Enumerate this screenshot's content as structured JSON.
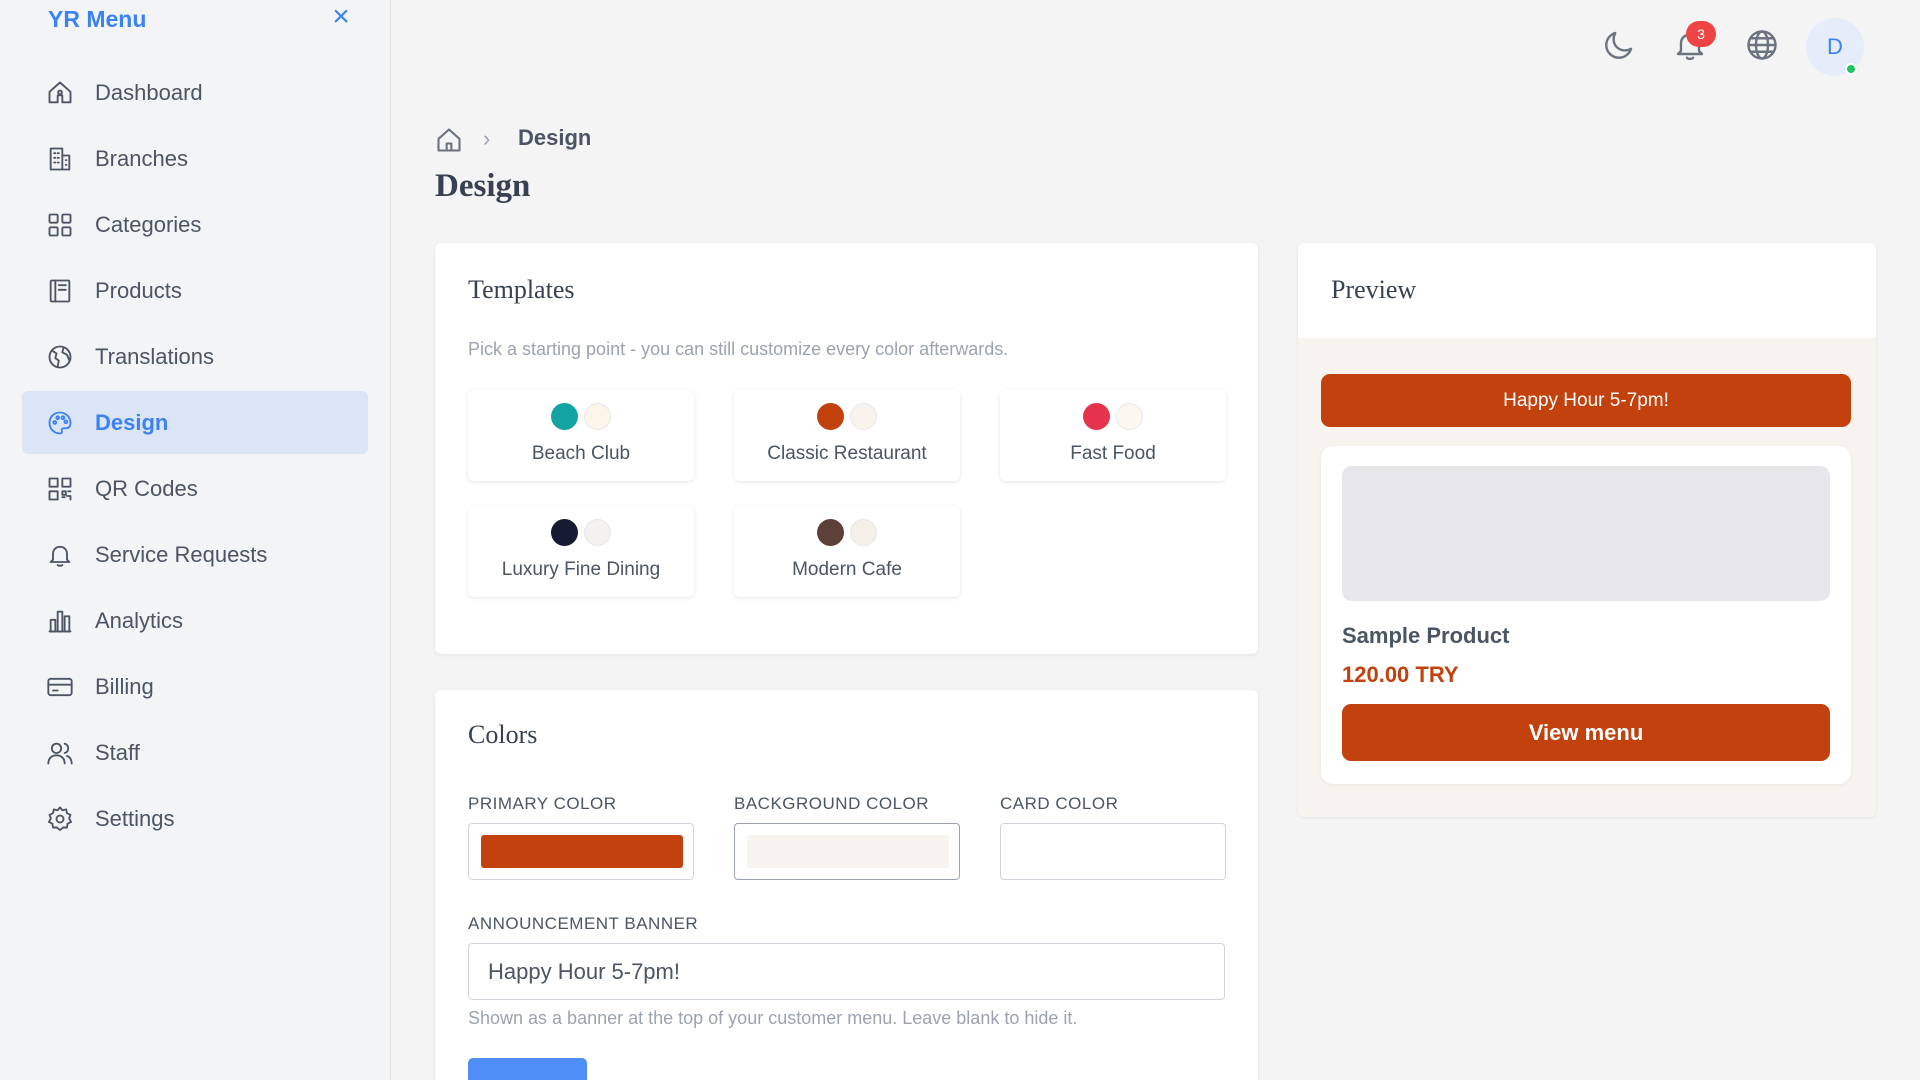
{
  "brand": {
    "title": "YR Menu",
    "close_icon": "close-icon"
  },
  "sidebar": {
    "items": [
      {
        "label": "Dashboard",
        "icon": "home-icon",
        "active": false
      },
      {
        "label": "Branches",
        "icon": "building-icon",
        "active": false
      },
      {
        "label": "Categories",
        "icon": "grid-icon",
        "active": false
      },
      {
        "label": "Products",
        "icon": "book-icon",
        "active": false
      },
      {
        "label": "Translations",
        "icon": "globe-icon",
        "active": false
      },
      {
        "label": "Design",
        "icon": "palette-icon",
        "active": true
      },
      {
        "label": "QR Codes",
        "icon": "qr-code-icon",
        "active": false
      },
      {
        "label": "Service Requests",
        "icon": "bell-icon",
        "active": false
      },
      {
        "label": "Analytics",
        "icon": "bar-chart-icon",
        "active": false
      },
      {
        "label": "Billing",
        "icon": "credit-card-icon",
        "active": false
      },
      {
        "label": "Staff",
        "icon": "users-icon",
        "active": false
      },
      {
        "label": "Settings",
        "icon": "gear-icon",
        "active": false
      }
    ]
  },
  "topbar": {
    "notification_count": "3",
    "avatar_initial": "D"
  },
  "breadcrumb": {
    "current": "Design",
    "separator": "›"
  },
  "page": {
    "title": "Design"
  },
  "templates": {
    "title": "Templates",
    "description": "Pick a starting point - you can still customize every color afterwards.",
    "items": [
      {
        "label": "Beach Club",
        "primary": "#14a3a3",
        "secondary": "#fdf6e8"
      },
      {
        "label": "Classic Restaurant",
        "primary": "#c2410c",
        "secondary": "#f8f3ed"
      },
      {
        "label": "Fast Food",
        "primary": "#e5334b",
        "secondary": "#fdf8ef"
      },
      {
        "label": "Luxury Fine Dining",
        "primary": "#171a33",
        "secondary": "#f3f2f1"
      },
      {
        "label": "Modern Cafe",
        "primary": "#5d4037",
        "secondary": "#f4efe9"
      }
    ]
  },
  "colors": {
    "title": "Colors",
    "primary_label": "PRIMARY COLOR",
    "primary_value": "#c2410c",
    "background_label": "BACKGROUND COLOR",
    "background_value": "#f7f3ee",
    "card_label": "CARD COLOR",
    "card_value": "#ffffff",
    "banner_label": "ANNOUNCEMENT BANNER",
    "banner_value": "Happy Hour 5-7pm!",
    "banner_help": "Shown as a banner at the top of your customer menu. Leave blank to hide it."
  },
  "preview": {
    "title": "Preview",
    "banner_text": "Happy Hour 5-7pm!",
    "product_name": "Sample Product",
    "product_price": "120.00 TRY",
    "cta_label": "View menu"
  }
}
